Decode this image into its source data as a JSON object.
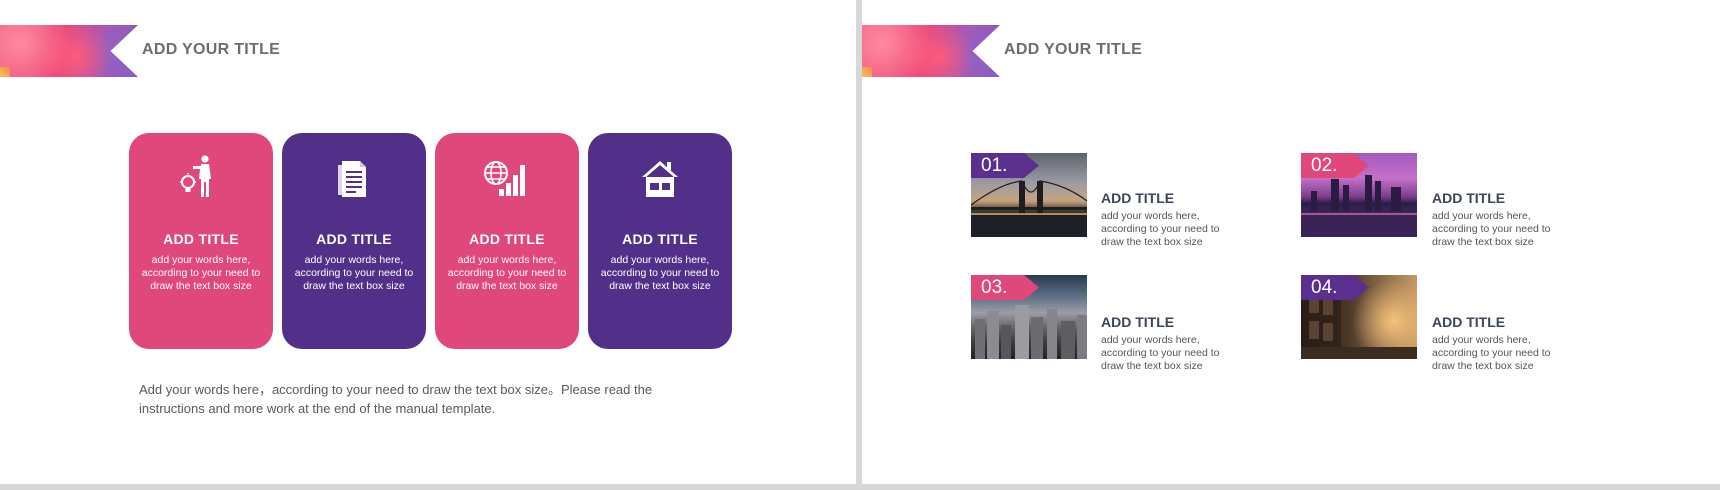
{
  "left_slide": {
    "title": "ADD YOUR TITLE",
    "cards": [
      {
        "title": "ADD TITLE",
        "text": "add your words here, according to your need to draw the text box size",
        "icon": "businessman-lightbulb-icon",
        "color": "#e0477b"
      },
      {
        "title": "ADD TITLE",
        "text": "add your words here, according to your need to draw the text box size",
        "icon": "document-icon",
        "color": "#523089"
      },
      {
        "title": "ADD TITLE",
        "text": "add your words here, according to your need to draw the text box size",
        "icon": "globe-chart-icon",
        "color": "#e0477b"
      },
      {
        "title": "ADD TITLE",
        "text": "add your words here, according to your need to draw the text box size",
        "icon": "house-icon",
        "color": "#523089"
      }
    ],
    "bottom_text": "Add your words here，according to your need to draw the text box size。Please read the instructions and more work at the end of the manual template."
  },
  "right_slide": {
    "title": "ADD YOUR TITLE",
    "items": [
      {
        "number": "01.",
        "title": "ADD TITLE",
        "text": "add your words here, according to your need to draw the text box size",
        "tag_color": "#5a2f8d"
      },
      {
        "number": "02.",
        "title": "ADD TITLE",
        "text": "add your words here, according to your need to draw the text box size",
        "tag_color": "#e0477b"
      },
      {
        "number": "03.",
        "title": "ADD TITLE",
        "text": "add your words here, according to your need to draw the text box size",
        "tag_color": "#e0477b"
      },
      {
        "number": "04.",
        "title": "ADD TITLE",
        "text": "add your words here, according to your need to draw the text box size",
        "tag_color": "#5a2f8d"
      }
    ]
  },
  "colors": {
    "pink": "#e0477b",
    "purple": "#523089",
    "title_gray": "#6d6d6d"
  }
}
